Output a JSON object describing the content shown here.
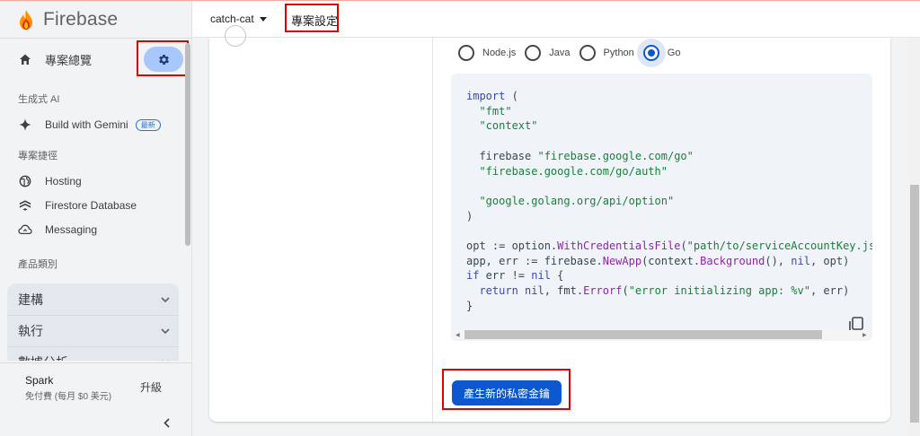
{
  "brand": {
    "name": "Firebase"
  },
  "sidebar": {
    "overview_label": "專案總覽",
    "section_genai": "生成式 AI",
    "gemini": {
      "label": "Build with Gemini",
      "badge": "最新"
    },
    "section_shortcuts": "專案捷徑",
    "shortcuts": [
      {
        "label": "Hosting",
        "icon": "globe-icon"
      },
      {
        "label": "Firestore Database",
        "icon": "firestore-icon"
      },
      {
        "label": "Messaging",
        "icon": "cloud-sync-icon"
      }
    ],
    "section_categories": "產品類別",
    "categories": [
      {
        "label": "建構"
      },
      {
        "label": "執行"
      },
      {
        "label": "數據分析"
      }
    ],
    "plan": {
      "name": "Spark",
      "desc": "免付費 (每月 $0 美元)",
      "upgrade": "升級"
    }
  },
  "topbar": {
    "project": "catch-cat",
    "page_title": "專案設定"
  },
  "sdk": {
    "languages": [
      {
        "label": "Node.js",
        "selected": false
      },
      {
        "label": "Java",
        "selected": false
      },
      {
        "label": "Python",
        "selected": false
      },
      {
        "label": "Go",
        "selected": true
      }
    ]
  },
  "generate_button": "產生新的私密金鑰",
  "colors": {
    "accent": "#0b57d0",
    "highlight": "#e00000",
    "gear_bg": "#a8c7fa"
  }
}
